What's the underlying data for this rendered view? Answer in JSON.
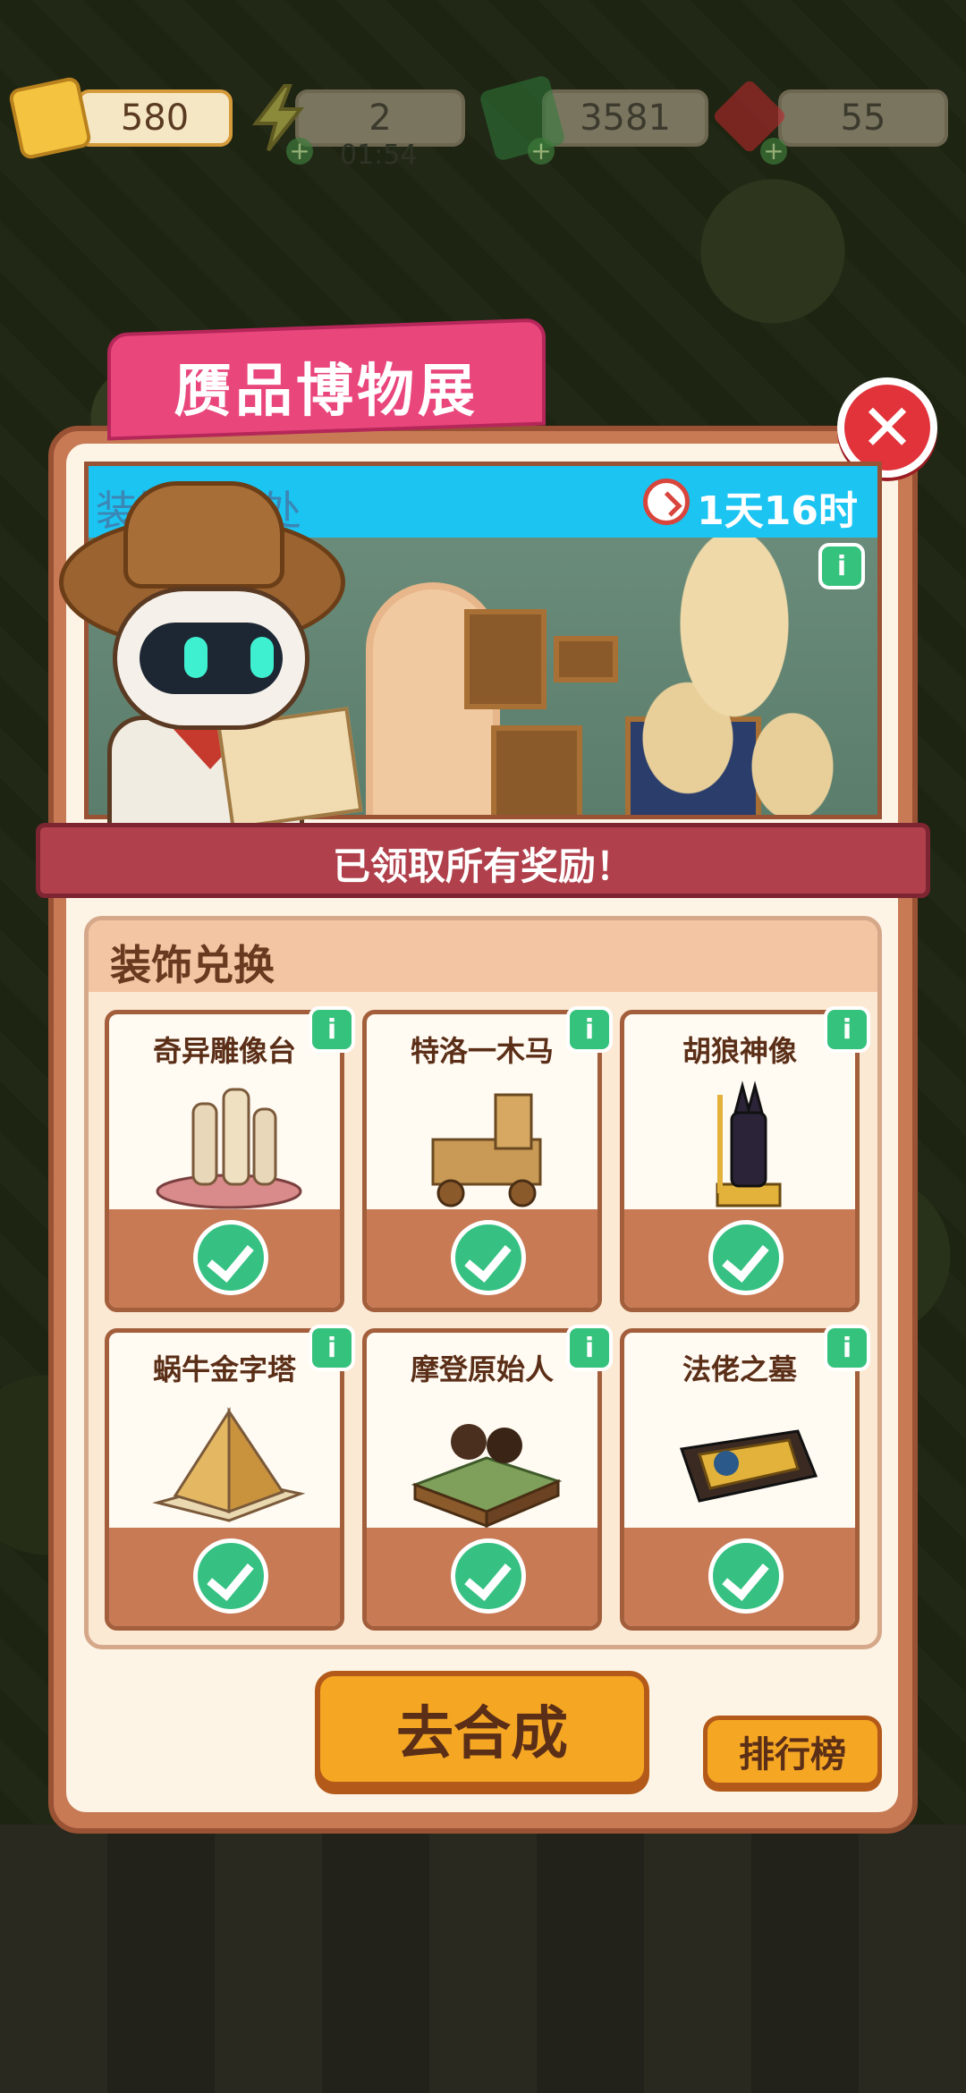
{
  "resources": {
    "tickets": "580",
    "energy": "2",
    "energy_timer": "01:54",
    "cash": "3581",
    "gems": "55"
  },
  "event": {
    "title": "赝品博物展",
    "banner_label": "装饰兑换处",
    "timer": "1天16时",
    "all_claimed": "已领取所有奖励！"
  },
  "exchange": {
    "section_title": "装饰兑换",
    "items": [
      {
        "name": "奇异雕像台",
        "claimed": true
      },
      {
        "name": "特洛一木马",
        "claimed": true
      },
      {
        "name": "胡狼神像",
        "claimed": true
      },
      {
        "name": "蜗牛金字塔",
        "claimed": true
      },
      {
        "name": "摩登原始人",
        "claimed": true
      },
      {
        "name": "法佬之墓",
        "claimed": true
      }
    ]
  },
  "buttons": {
    "go_merge": "去合成",
    "leaderboard": "排行榜"
  },
  "colors": {
    "title_pink": "#e9467c",
    "banner_blue": "#1cc4f2",
    "panel_brown": "#c87a55",
    "check_green": "#36c183",
    "button_orange": "#f5a623"
  }
}
